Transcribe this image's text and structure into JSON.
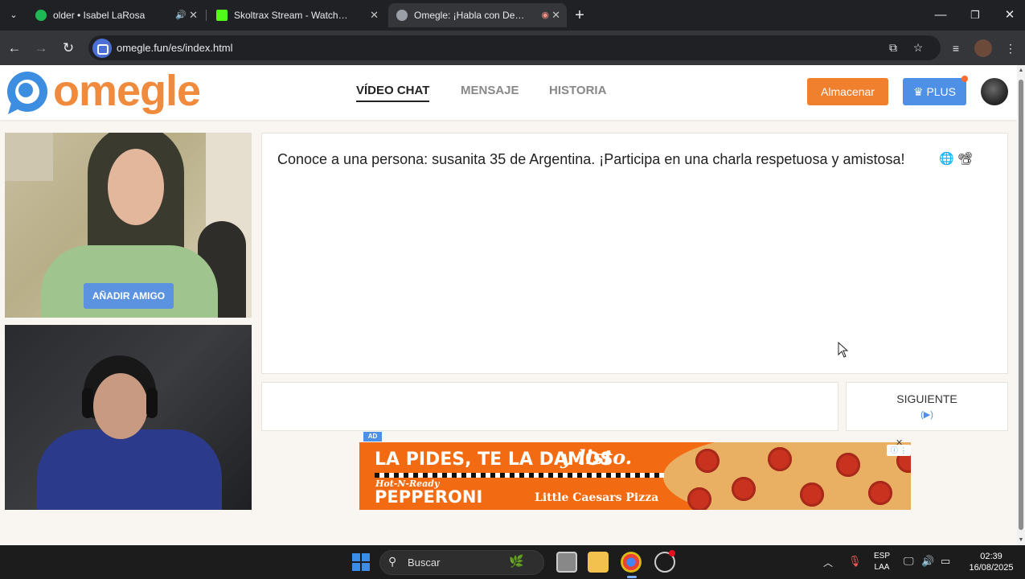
{
  "browser": {
    "tabs": [
      {
        "title": "older • Isabel LaRosa",
        "favicon": "spotify-icon",
        "color": "#1db954",
        "audio": true,
        "active": false
      },
      {
        "title": "Skoltrax Stream - Watch Live on",
        "favicon": "kick-icon",
        "color": "#53fc18",
        "audio": false,
        "active": false
      },
      {
        "title": "Omegle: ¡Habla con Desconocid",
        "favicon": "globe-icon",
        "color": "#9aa0a6",
        "audio": false,
        "recording": true,
        "active": true
      }
    ],
    "url": "omegle.fun/es/index.html"
  },
  "site": {
    "logo_text": "omegle",
    "nav": [
      {
        "label": "VÍDEO CHAT",
        "active": true
      },
      {
        "label": "MENSAJE",
        "active": false
      },
      {
        "label": "HISTORIA",
        "active": false
      }
    ],
    "store_label": "Almacenar",
    "plus_label": "PLUS"
  },
  "stranger_video": {
    "add_friend_label": "AÑADIR AMIGO"
  },
  "chat": {
    "message": "Conoce a una persona: susanita 35 de Argentina. ¡Participa en una charla respetuosa y amistosa!",
    "icons": [
      "globe-icon",
      "camera-icon"
    ],
    "input_value": "",
    "next_label": "SIGUIENTE",
    "next_icon": "(▶)"
  },
  "ad": {
    "tag": "AD",
    "line1": "LA PIDES, TE LA DAMOS",
    "line1_script": "y listo.",
    "line2": "Hot-N-Ready",
    "line3": "PEPPERONI",
    "brand": "Little Caesars Pizza",
    "close": "✕"
  },
  "taskbar": {
    "search_placeholder": "Buscar",
    "lang_top": "ESP",
    "lang_bottom": "LAA",
    "time": "02:39",
    "date": "16/08/2025"
  },
  "colors": {
    "accent_orange": "#f07f2e",
    "accent_blue": "#4d90e6"
  }
}
